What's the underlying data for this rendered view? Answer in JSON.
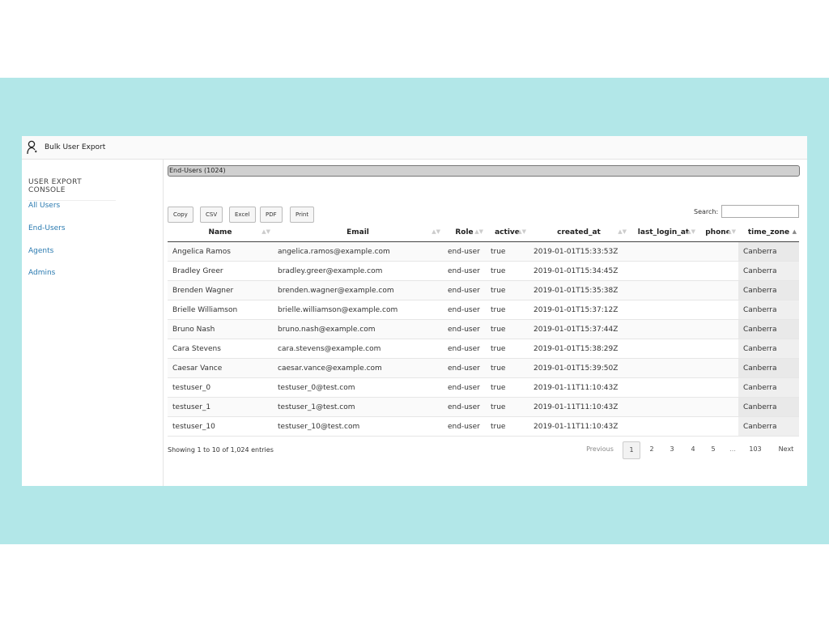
{
  "app": {
    "title": "Bulk User Export"
  },
  "sidebar": {
    "heading": "USER EXPORT CONSOLE",
    "items": [
      {
        "label": "All Users"
      },
      {
        "label": "End-Users"
      },
      {
        "label": "Agents"
      },
      {
        "label": "Admins"
      }
    ]
  },
  "main": {
    "tab_title": "End-Users (1024)",
    "buttons": {
      "copy": "Copy",
      "csv": "CSV",
      "excel": "Excel",
      "pdf": "PDF",
      "print": "Print"
    },
    "search": {
      "label": "Search:",
      "value": ""
    },
    "table": {
      "columns": [
        "Name",
        "Email",
        "Role",
        "active",
        "created_at",
        "last_login_at",
        "phone",
        "time_zone"
      ],
      "sorted_column": "time_zone",
      "rows": [
        [
          "Angelica Ramos",
          "angelica.ramos@example.com",
          "end-user",
          "true",
          "2019-01-01T15:33:53Z",
          "",
          "",
          "Canberra"
        ],
        [
          "Bradley Greer",
          "bradley.greer@example.com",
          "end-user",
          "true",
          "2019-01-01T15:34:45Z",
          "",
          "",
          "Canberra"
        ],
        [
          "Brenden Wagner",
          "brenden.wagner@example.com",
          "end-user",
          "true",
          "2019-01-01T15:35:38Z",
          "",
          "",
          "Canberra"
        ],
        [
          "Brielle Williamson",
          "brielle.williamson@example.com",
          "end-user",
          "true",
          "2019-01-01T15:37:12Z",
          "",
          "",
          "Canberra"
        ],
        [
          "Bruno Nash",
          "bruno.nash@example.com",
          "end-user",
          "true",
          "2019-01-01T15:37:44Z",
          "",
          "",
          "Canberra"
        ],
        [
          "Cara Stevens",
          "cara.stevens@example.com",
          "end-user",
          "true",
          "2019-01-01T15:38:29Z",
          "",
          "",
          "Canberra"
        ],
        [
          "Caesar Vance",
          "caesar.vance@example.com",
          "end-user",
          "true",
          "2019-01-01T15:39:50Z",
          "",
          "",
          "Canberra"
        ],
        [
          "testuser_0",
          "testuser_0@test.com",
          "end-user",
          "true",
          "2019-01-11T11:10:43Z",
          "",
          "",
          "Canberra"
        ],
        [
          "testuser_1",
          "testuser_1@test.com",
          "end-user",
          "true",
          "2019-01-11T11:10:43Z",
          "",
          "",
          "Canberra"
        ],
        [
          "testuser_10",
          "testuser_10@test.com",
          "end-user",
          "true",
          "2019-01-11T11:10:43Z",
          "",
          "",
          "Canberra"
        ]
      ]
    },
    "info": "Showing 1 to 10 of 1,024 entries",
    "pagination": {
      "previous": "Previous",
      "pages": [
        "1",
        "2",
        "3",
        "4",
        "5"
      ],
      "ellipsis": "…",
      "last": "103",
      "next": "Next",
      "current": "1"
    }
  },
  "colors": {
    "background_band": "#b2e7e8",
    "link": "#2a7ab0"
  },
  "icons": {
    "app": "user-icon",
    "sort": "sort-arrows-icon"
  }
}
